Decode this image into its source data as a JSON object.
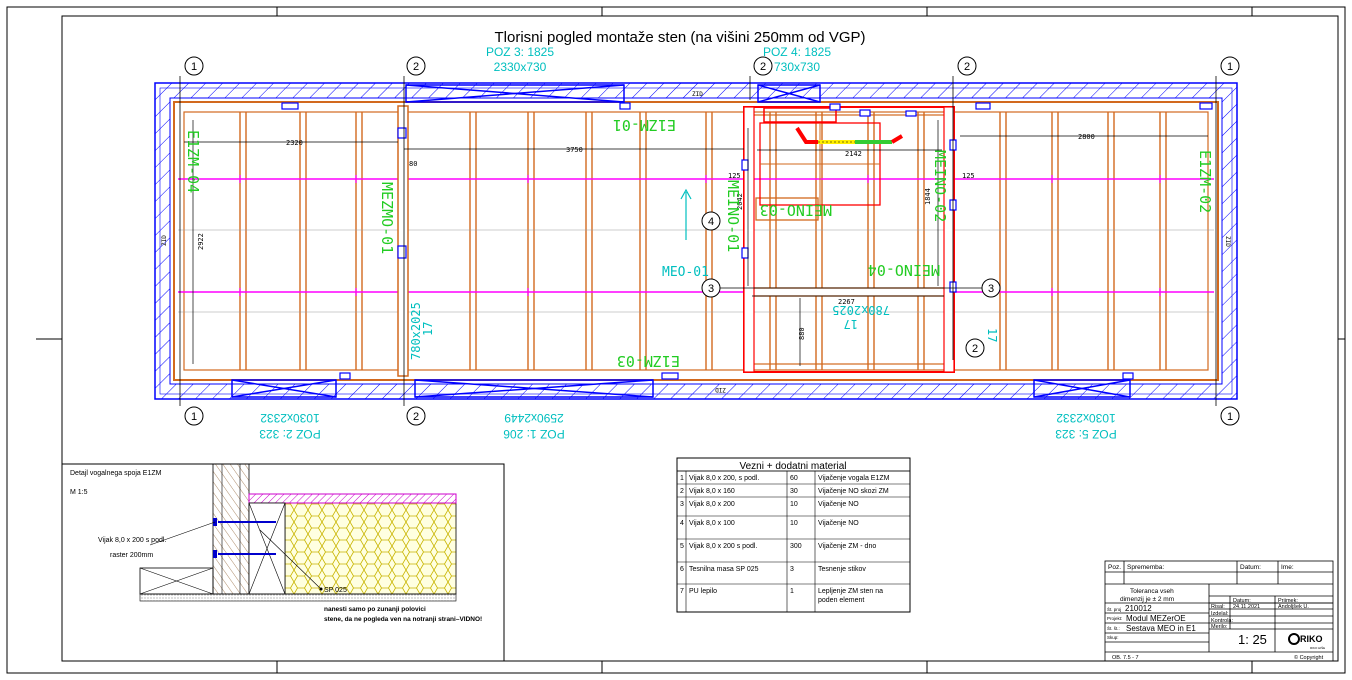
{
  "title": "Tlorisni pogled montaže sten (na višini 250mm od VGP)",
  "grid_labels": {
    "one": "1",
    "two": "2",
    "three": "3",
    "four": "4"
  },
  "positions_top": [
    {
      "line1": "POZ 3: 1825",
      "line2": "2330x730"
    },
    {
      "line1": "POZ 4: 1825",
      "line2": "730x730"
    }
  ],
  "positions_bottom": [
    {
      "line1": "POZ 2: 323",
      "line2": "1030x2332"
    },
    {
      "line1": "POZ 1: 206",
      "line2": "2590x2449"
    },
    {
      "line1": "POZ 5: 323",
      "line2": "1030x2332"
    }
  ],
  "wall_labels": {
    "e1zm_01": "E1ZM-01",
    "e1zm_02": "E1ZM-02",
    "e1zm_03": "E1ZM-03",
    "e1zm_04": "E1ZM-04",
    "mezmo_01": "MEZMO-01",
    "meino_01": "MEINO-01",
    "meino_02": "MEINO-02",
    "meino_03": "MEINO-03",
    "meino_04": "MEINO-04",
    "meo_01": "MEO-01"
  },
  "opening_labels": {
    "o1_a": "17",
    "o1_b": "780x2025",
    "o2_a": "17",
    "o2_b": "780x2025",
    "o3_a": "17"
  },
  "dimensions": {
    "d2320": "2320",
    "d3750": "3750",
    "d80": "80",
    "d2922": "2922",
    "d2800": "2800",
    "d125a": "125",
    "d125b": "125",
    "d2142": "2142",
    "d2042": "2042",
    "d1844": "1844",
    "d2267": "2267",
    "d880": "880"
  },
  "side_tags": {
    "zid_left": "ZID",
    "zid_top": "ZID",
    "zid_bottom": "ZID",
    "zid_right": "ZID"
  },
  "detail": {
    "title": "Detajl vogalnega spoja E1ZM",
    "scale": "M 1:5",
    "screw_line1": "Vijak 8,0 x 200 s podl.",
    "screw_line2": "raster 200mm",
    "sealant": "SP 025",
    "note_line1": "nanesti samo po zunanji polovici",
    "note_line2": "stene, da ne pogleda ven na notranji strani–VIDNO!"
  },
  "material_table": {
    "title": "Vezni + dodatni material",
    "rows": [
      {
        "n": "1",
        "item": "Vijak 8,0 x 200, s podl.",
        "qty": "60",
        "use": "Vijačenje vogala E1ZM",
        "use2": ""
      },
      {
        "n": "2",
        "item": "Vijak 8,0 x 160",
        "qty": "30",
        "use": "Vijačenje NO skozi ZM",
        "use2": ""
      },
      {
        "n": "3",
        "item": "Vijak 8,0 x 200",
        "qty": "10",
        "use": "Vijačenje NO",
        "use2": ""
      },
      {
        "n": "4",
        "item": "Vijak 8,0 x 100",
        "qty": "10",
        "use": "Vijačenje NO",
        "use2": ""
      },
      {
        "n": "5",
        "item": "Vijak 8,0 x 200 s podl.",
        "qty": "300",
        "use": "Vijačenje ZM - dno",
        "use2": ""
      },
      {
        "n": "6",
        "item": "Tesnilna masa SP 025",
        "qty": "3",
        "use": "Tesnenje stikov",
        "use2": ""
      },
      {
        "n": "7",
        "item": "PU lepilo",
        "qty": "1",
        "use": "Lepljenje ZM sten na",
        "use2": "poden element"
      }
    ]
  },
  "title_block": {
    "h_poz": "Poz.",
    "h_spr": "Sprememba:",
    "h_datum": "Datum:",
    "h_ime": "Ime:",
    "tol1": "Toleranca vseh",
    "tol2": "dimenzij je ± 2 mm",
    "lbl_st": "Št. proj",
    "val_st": "210012",
    "lbl_proj": "Projekt:",
    "val_proj": "Modul MEZerOE",
    "lbl_sst": "Št. št.:",
    "val_sst": "Sestava MEO in E1",
    "lbl_skup": "Skup:",
    "lbl_risal": "Risal:",
    "lbl_izdelal": "Izdelal:",
    "lbl_kontrola": "Kontrola:",
    "lbl_merilo": "Merilo:",
    "col_datum": "Datum:",
    "col_priimek": "Priimek:",
    "val_datum": "24.11.2021",
    "val_priimek": "Andoljšek U.",
    "scale": "1: 25",
    "logo": "RIKO",
    "logo_sub": "RIKO HIŠE",
    "copyright": "© Copyright",
    "form": "OB. 7.5 - 7"
  },
  "colors": {
    "blue": "#0000ff",
    "magenta": "#ff00ff",
    "green": "#00cc00",
    "cyan": "#00cccc",
    "orange": "#d2691e",
    "red": "#ff0000",
    "yellow": "#ffff00"
  }
}
